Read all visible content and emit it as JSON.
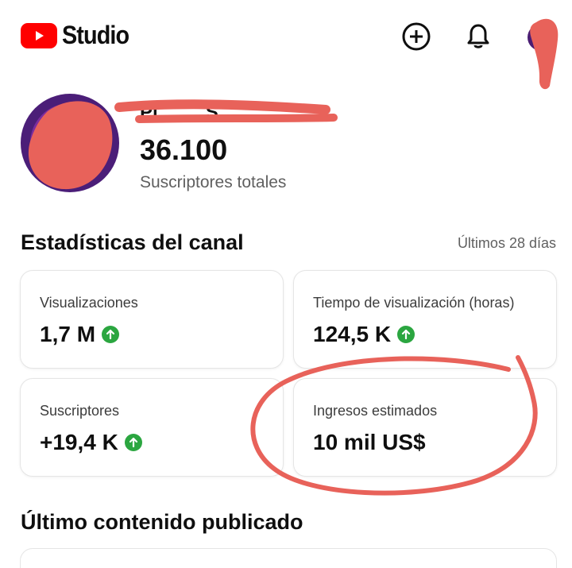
{
  "header": {
    "app_name": "Studio",
    "icons": [
      "youtube-logo-icon",
      "create-icon",
      "bell-icon",
      "avatar"
    ]
  },
  "channel": {
    "name": "Pl____ S____",
    "subscriber_count": "36.100",
    "subscriber_label": "Suscriptores totales"
  },
  "stats": {
    "title": "Estadísticas del canal",
    "range": "Últimos 28 días",
    "cards": [
      {
        "label": "Visualizaciones",
        "value": "1,7 M",
        "trend": "up"
      },
      {
        "label": "Tiempo de visualización (horas)",
        "value": "124,5 K",
        "trend": "up"
      },
      {
        "label": "Suscriptores",
        "value": "+19,4 K",
        "trend": "up"
      },
      {
        "label": "Ingresos estimados",
        "value": "10 mil US$",
        "trend": ""
      }
    ]
  },
  "latest": {
    "title": "Último contenido publicado"
  },
  "colors": {
    "brand_red": "#ff0000",
    "trend_green": "#2ba640",
    "annotation_red": "#e8625a",
    "avatar_purple": "#4b1e78"
  }
}
